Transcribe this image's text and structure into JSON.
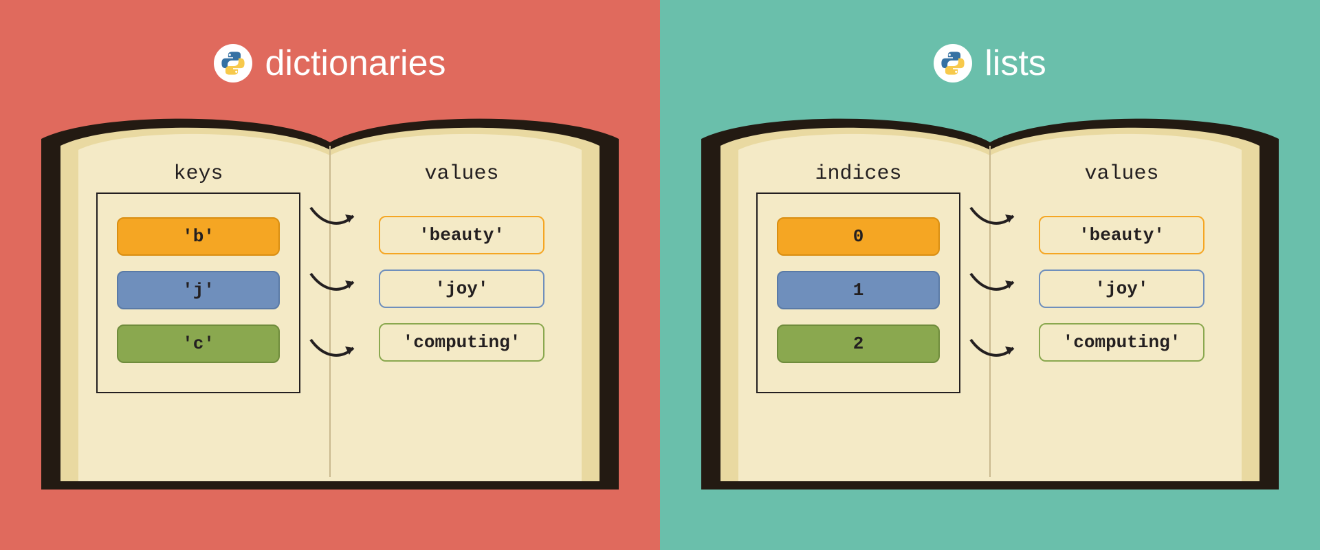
{
  "panels": {
    "dictionaries": {
      "title": "dictionaries",
      "leftHeader": "keys",
      "rightHeader": "values",
      "rows": [
        {
          "key": "'b'",
          "value": "'beauty'"
        },
        {
          "key": "'j'",
          "value": "'joy'"
        },
        {
          "key": "'c'",
          "value": "'computing'"
        }
      ]
    },
    "lists": {
      "title": "lists",
      "leftHeader": "indices",
      "rightHeader": "values",
      "rows": [
        {
          "key": "0",
          "value": "'beauty'"
        },
        {
          "key": "1",
          "value": "'joy'"
        },
        {
          "key": "2",
          "value": "'computing'"
        }
      ]
    }
  },
  "colors": {
    "row": [
      "#f5a623",
      "#6f8fbc",
      "#8aa84f"
    ],
    "panelLeft": "#e06a5d",
    "panelRight": "#6abfab",
    "pageLight": "#f4eac6",
    "pageShadow": "#e9d9a1",
    "cover": "#231a12"
  }
}
